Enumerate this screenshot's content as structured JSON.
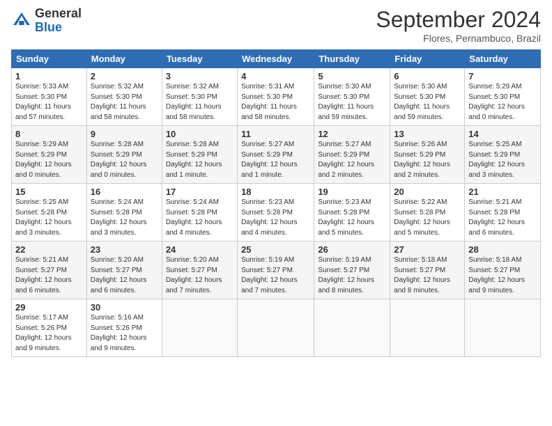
{
  "header": {
    "logo_general": "General",
    "logo_blue": "Blue",
    "month_title": "September 2024",
    "location": "Flores, Pernambuco, Brazil"
  },
  "days_of_week": [
    "Sunday",
    "Monday",
    "Tuesday",
    "Wednesday",
    "Thursday",
    "Friday",
    "Saturday"
  ],
  "weeks": [
    [
      {
        "day": "1",
        "sunrise": "5:33 AM",
        "sunset": "5:30 PM",
        "daylight": "11 hours and 57 minutes."
      },
      {
        "day": "2",
        "sunrise": "5:32 AM",
        "sunset": "5:30 PM",
        "daylight": "11 hours and 58 minutes."
      },
      {
        "day": "3",
        "sunrise": "5:32 AM",
        "sunset": "5:30 PM",
        "daylight": "11 hours and 58 minutes."
      },
      {
        "day": "4",
        "sunrise": "5:31 AM",
        "sunset": "5:30 PM",
        "daylight": "11 hours and 58 minutes."
      },
      {
        "day": "5",
        "sunrise": "5:30 AM",
        "sunset": "5:30 PM",
        "daylight": "11 hours and 59 minutes."
      },
      {
        "day": "6",
        "sunrise": "5:30 AM",
        "sunset": "5:30 PM",
        "daylight": "11 hours and 59 minutes."
      },
      {
        "day": "7",
        "sunrise": "5:29 AM",
        "sunset": "5:30 PM",
        "daylight": "12 hours and 0 minutes."
      }
    ],
    [
      {
        "day": "8",
        "sunrise": "5:29 AM",
        "sunset": "5:29 PM",
        "daylight": "12 hours and 0 minutes."
      },
      {
        "day": "9",
        "sunrise": "5:28 AM",
        "sunset": "5:29 PM",
        "daylight": "12 hours and 0 minutes."
      },
      {
        "day": "10",
        "sunrise": "5:28 AM",
        "sunset": "5:29 PM",
        "daylight": "12 hours and 1 minute."
      },
      {
        "day": "11",
        "sunrise": "5:27 AM",
        "sunset": "5:29 PM",
        "daylight": "12 hours and 1 minute."
      },
      {
        "day": "12",
        "sunrise": "5:27 AM",
        "sunset": "5:29 PM",
        "daylight": "12 hours and 2 minutes."
      },
      {
        "day": "13",
        "sunrise": "5:26 AM",
        "sunset": "5:29 PM",
        "daylight": "12 hours and 2 minutes."
      },
      {
        "day": "14",
        "sunrise": "5:25 AM",
        "sunset": "5:29 PM",
        "daylight": "12 hours and 3 minutes."
      }
    ],
    [
      {
        "day": "15",
        "sunrise": "5:25 AM",
        "sunset": "5:28 PM",
        "daylight": "12 hours and 3 minutes."
      },
      {
        "day": "16",
        "sunrise": "5:24 AM",
        "sunset": "5:28 PM",
        "daylight": "12 hours and 3 minutes."
      },
      {
        "day": "17",
        "sunrise": "5:24 AM",
        "sunset": "5:28 PM",
        "daylight": "12 hours and 4 minutes."
      },
      {
        "day": "18",
        "sunrise": "5:23 AM",
        "sunset": "5:28 PM",
        "daylight": "12 hours and 4 minutes."
      },
      {
        "day": "19",
        "sunrise": "5:23 AM",
        "sunset": "5:28 PM",
        "daylight": "12 hours and 5 minutes."
      },
      {
        "day": "20",
        "sunrise": "5:22 AM",
        "sunset": "5:28 PM",
        "daylight": "12 hours and 5 minutes."
      },
      {
        "day": "21",
        "sunrise": "5:21 AM",
        "sunset": "5:28 PM",
        "daylight": "12 hours and 6 minutes."
      }
    ],
    [
      {
        "day": "22",
        "sunrise": "5:21 AM",
        "sunset": "5:27 PM",
        "daylight": "12 hours and 6 minutes."
      },
      {
        "day": "23",
        "sunrise": "5:20 AM",
        "sunset": "5:27 PM",
        "daylight": "12 hours and 6 minutes."
      },
      {
        "day": "24",
        "sunrise": "5:20 AM",
        "sunset": "5:27 PM",
        "daylight": "12 hours and 7 minutes."
      },
      {
        "day": "25",
        "sunrise": "5:19 AM",
        "sunset": "5:27 PM",
        "daylight": "12 hours and 7 minutes."
      },
      {
        "day": "26",
        "sunrise": "5:19 AM",
        "sunset": "5:27 PM",
        "daylight": "12 hours and 8 minutes."
      },
      {
        "day": "27",
        "sunrise": "5:18 AM",
        "sunset": "5:27 PM",
        "daylight": "12 hours and 8 minutes."
      },
      {
        "day": "28",
        "sunrise": "5:18 AM",
        "sunset": "5:27 PM",
        "daylight": "12 hours and 9 minutes."
      }
    ],
    [
      {
        "day": "29",
        "sunrise": "5:17 AM",
        "sunset": "5:26 PM",
        "daylight": "12 hours and 9 minutes."
      },
      {
        "day": "30",
        "sunrise": "5:16 AM",
        "sunset": "5:26 PM",
        "daylight": "12 hours and 9 minutes."
      },
      null,
      null,
      null,
      null,
      null
    ]
  ]
}
